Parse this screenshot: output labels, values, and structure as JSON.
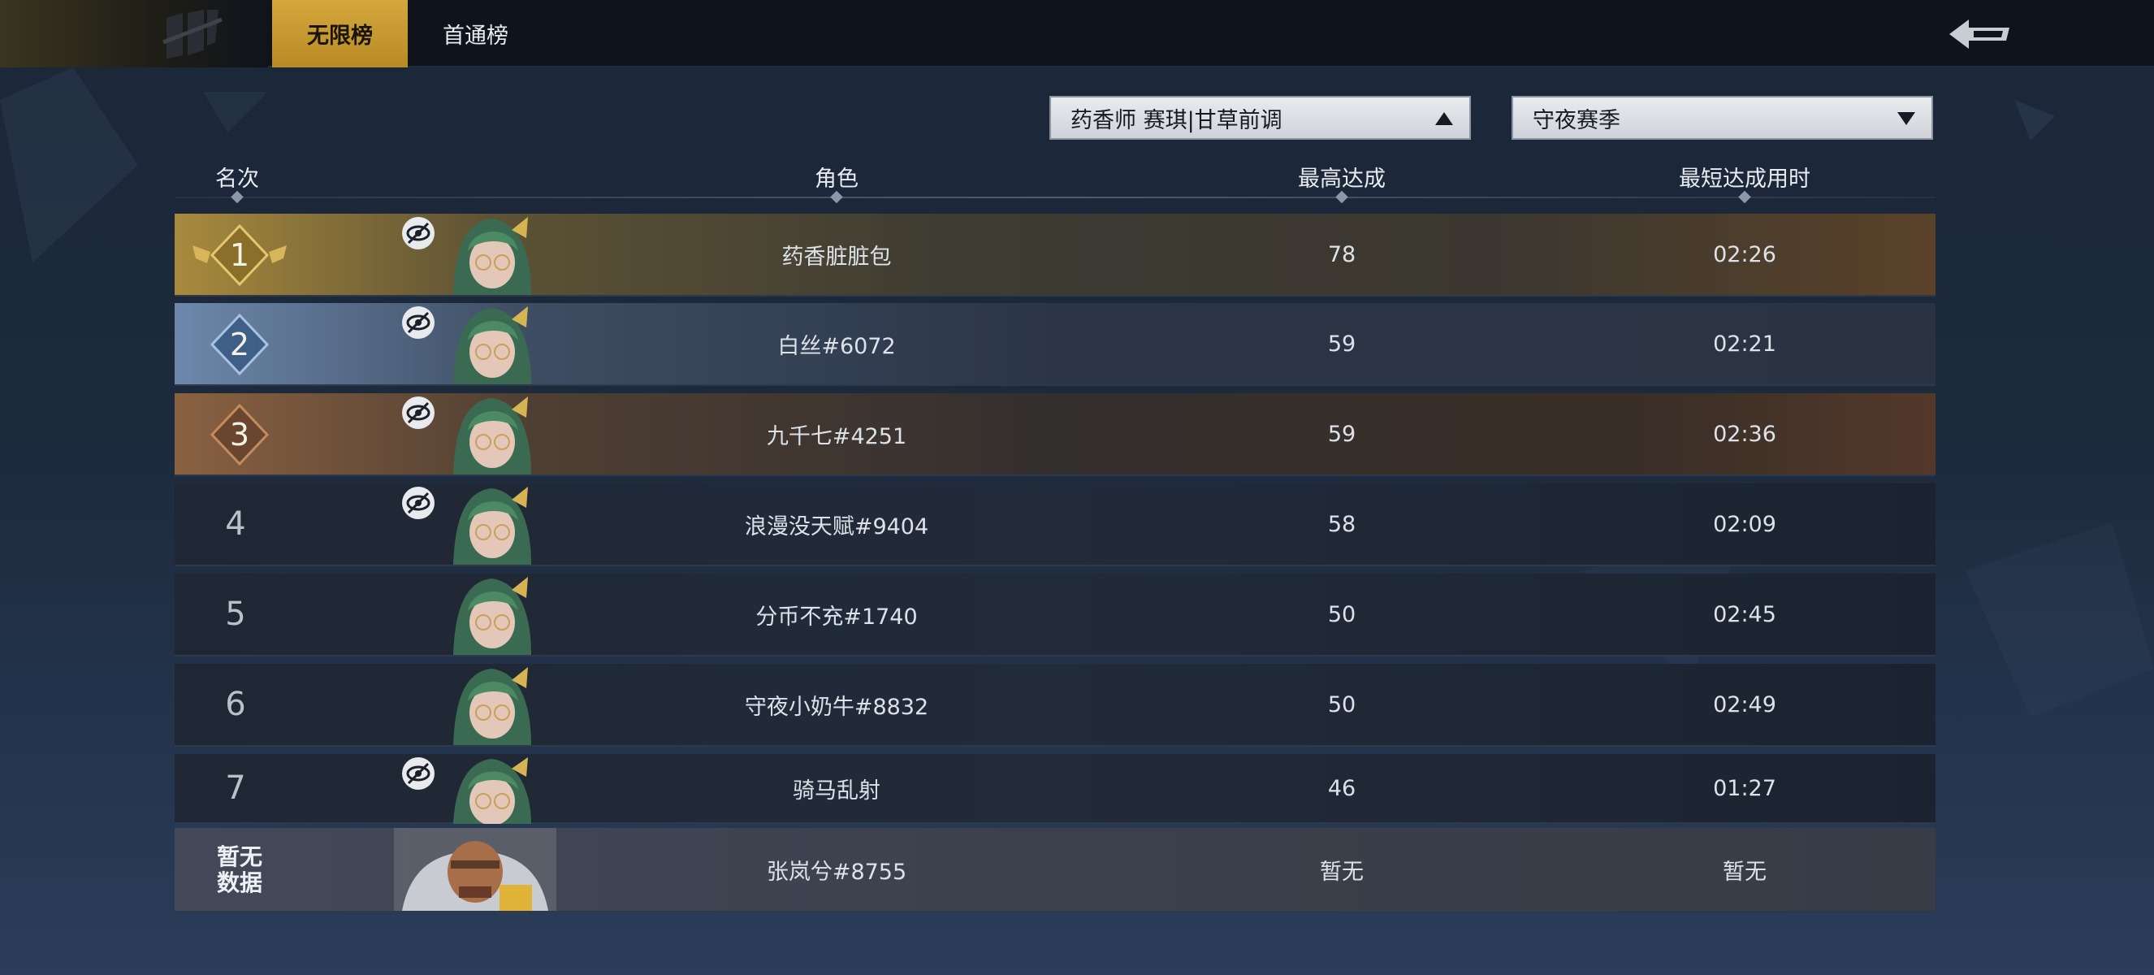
{
  "tabs": [
    {
      "label": "无限榜",
      "active": true
    },
    {
      "label": "首通榜",
      "active": false
    }
  ],
  "icons": {
    "logo": "game-logo-icon",
    "back": "back-arrow-icon",
    "hidden": "eye-hidden-icon",
    "dropdown_up": "triangle-up-icon",
    "dropdown_down": "triangle-down-icon"
  },
  "filters": {
    "character": {
      "value": "药香师 赛琪|甘草前调",
      "expanded": true
    },
    "season": {
      "value": "守夜赛季",
      "expanded": false
    }
  },
  "columns": {
    "rank": "名次",
    "character": "角色",
    "best": "最高达成",
    "fastest": "最短达成用时"
  },
  "rows": [
    {
      "rank": "1",
      "name": "药香脏脏包",
      "best": "78",
      "time": "02:26",
      "hidden": true,
      "tier": "gold"
    },
    {
      "rank": "2",
      "name": "白丝#6072",
      "best": "59",
      "time": "02:21",
      "hidden": true,
      "tier": "silver"
    },
    {
      "rank": "3",
      "name": "九千七#4251",
      "best": "59",
      "time": "02:36",
      "hidden": true,
      "tier": "bronze"
    },
    {
      "rank": "4",
      "name": "浪漫没天赋#9404",
      "best": "58",
      "time": "02:09",
      "hidden": true,
      "tier": "normal"
    },
    {
      "rank": "5",
      "name": "分币不充#1740",
      "best": "50",
      "time": "02:45",
      "hidden": false,
      "tier": "normal"
    },
    {
      "rank": "6",
      "name": "守夜小奶牛#8832",
      "best": "50",
      "time": "02:49",
      "hidden": false,
      "tier": "normal"
    },
    {
      "rank": "7",
      "name": "骑马乱射",
      "best": "46",
      "time": "01:27",
      "hidden": true,
      "tier": "normal"
    }
  ],
  "self_row": {
    "rank": "暂无数据",
    "rank_line1": "暂无",
    "rank_line2": "数据",
    "name": "张岚兮#8755",
    "best": "暂无",
    "time": "暂无"
  },
  "colors": {
    "accent_gold": "#c99a2e",
    "silver": "#6d88ab",
    "bronze": "#8a6141"
  }
}
